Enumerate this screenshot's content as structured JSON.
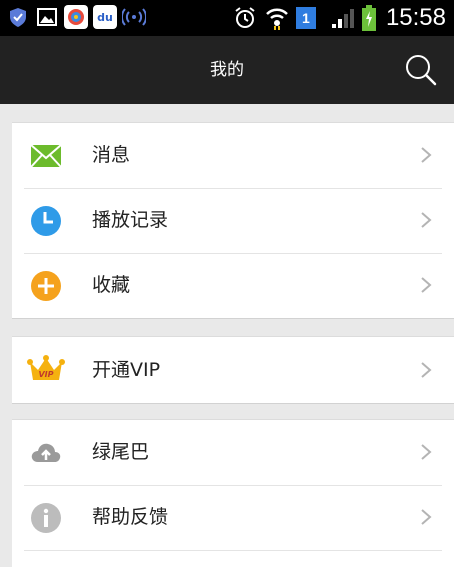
{
  "status_bar": {
    "time": "15:58",
    "sim_badge": "1",
    "baidu_label": "du",
    "icons": [
      "shield-icon",
      "gallery-icon",
      "media-app-icon",
      "baidu-icon",
      "signal-broadcast-icon",
      "alarm-icon",
      "wifi-icon",
      "sim-badge-icon",
      "cell-signal-icon",
      "battery-icon"
    ]
  },
  "header": {
    "title": "我的",
    "search_icon": "search-icon"
  },
  "menu_groups": [
    {
      "items": [
        {
          "label": "消息",
          "icon": "envelope-icon",
          "color": "#6cbb2c"
        },
        {
          "label": "播放记录",
          "icon": "clock-icon",
          "color": "#2f9be8"
        },
        {
          "label": "收藏",
          "icon": "plus-circle-icon",
          "color": "#f5a21d"
        }
      ]
    },
    {
      "items": [
        {
          "label": "开通VIP",
          "icon": "vip-crown-icon",
          "color": "#f5b10f"
        }
      ]
    },
    {
      "items": [
        {
          "label": "绿尾巴",
          "icon": "cloud-upload-icon",
          "color": "#9a9a9a"
        },
        {
          "label": "帮助反馈",
          "icon": "info-icon",
          "color": "#bcbcbc"
        }
      ]
    }
  ],
  "vip_badge_text": "VIP",
  "colors": {
    "title_bar": "#222222",
    "background": "#e9e9e9",
    "chevron": "#b4b4b4"
  }
}
